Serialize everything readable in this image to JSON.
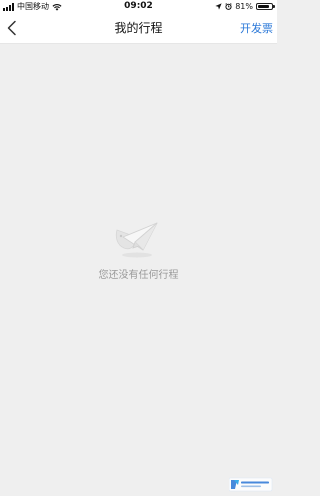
{
  "status_bar": {
    "carrier": "中国移动",
    "time": "09:02",
    "battery_percent": "81%",
    "battery_level": 0.81,
    "icons": [
      "signal-icon",
      "wifi-icon",
      "location-icon",
      "alarm-icon",
      "battery-icon"
    ]
  },
  "nav": {
    "back_icon": "chevron-left-icon",
    "title": "我的行程",
    "action_label": "开发票"
  },
  "empty_state": {
    "icon": "paper-plane-icon",
    "message": "您还没有任何行程"
  },
  "colors": {
    "background": "#efefef",
    "bar_background": "#ffffff",
    "accent": "#2b78d8",
    "muted_text": "#9a9a9a"
  }
}
